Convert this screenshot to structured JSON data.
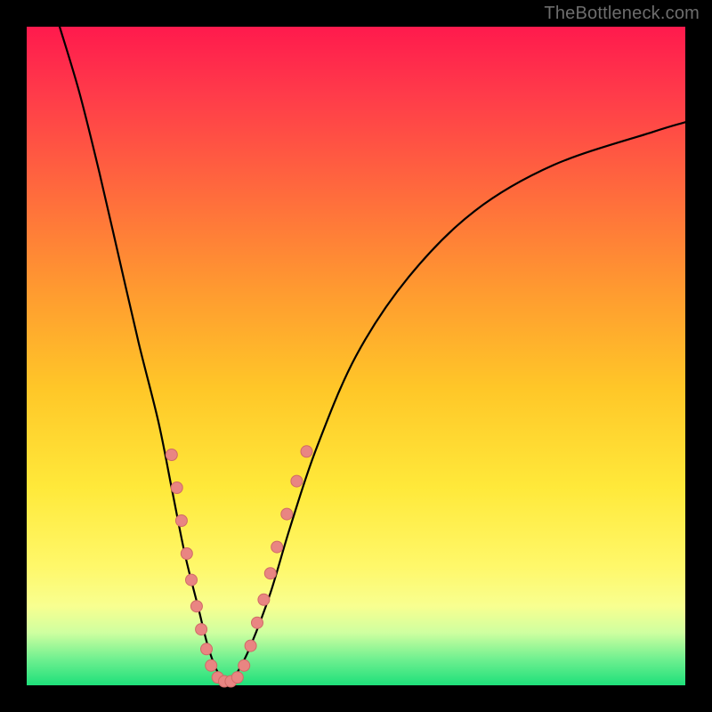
{
  "watermark": "TheBottleneck.com",
  "colors": {
    "frame": "#000000",
    "curve": "#000000",
    "marker_fill": "#e98582",
    "marker_stroke": "#d06a66"
  },
  "chart_data": {
    "type": "line",
    "title": "",
    "xlabel": "",
    "ylabel": "",
    "xlim": [
      0,
      100
    ],
    "ylim": [
      0,
      100
    ],
    "grid": false,
    "legend": false,
    "series": [
      {
        "name": "bottleneck-curve",
        "x": [
          5,
          8,
          11,
          14,
          17,
          20,
          22,
          24,
          26,
          27.5,
          29,
          30.5,
          32,
          34,
          37,
          40,
          44,
          50,
          58,
          68,
          80,
          95,
          100
        ],
        "y": [
          100,
          90,
          78,
          65,
          52,
          40,
          30,
          20,
          12,
          6,
          2,
          0.5,
          2,
          6,
          14,
          24,
          36,
          50,
          62,
          72,
          79,
          84,
          85.5
        ]
      }
    ],
    "markers": [
      {
        "x": 22.0,
        "y": 35.0
      },
      {
        "x": 22.8,
        "y": 30.0
      },
      {
        "x": 23.5,
        "y": 25.0
      },
      {
        "x": 24.3,
        "y": 20.0
      },
      {
        "x": 25.0,
        "y": 16.0
      },
      {
        "x": 25.8,
        "y": 12.0
      },
      {
        "x": 26.5,
        "y": 8.5
      },
      {
        "x": 27.3,
        "y": 5.5
      },
      {
        "x": 28.0,
        "y": 3.0
      },
      {
        "x": 29.0,
        "y": 1.2
      },
      {
        "x": 30.0,
        "y": 0.6
      },
      {
        "x": 31.0,
        "y": 0.6
      },
      {
        "x": 32.0,
        "y": 1.2
      },
      {
        "x": 33.0,
        "y": 3.0
      },
      {
        "x": 34.0,
        "y": 6.0
      },
      {
        "x": 35.0,
        "y": 9.5
      },
      {
        "x": 36.0,
        "y": 13.0
      },
      {
        "x": 37.0,
        "y": 17.0
      },
      {
        "x": 38.0,
        "y": 21.0
      },
      {
        "x": 39.5,
        "y": 26.0
      },
      {
        "x": 41.0,
        "y": 31.0
      },
      {
        "x": 42.5,
        "y": 35.5
      }
    ]
  }
}
